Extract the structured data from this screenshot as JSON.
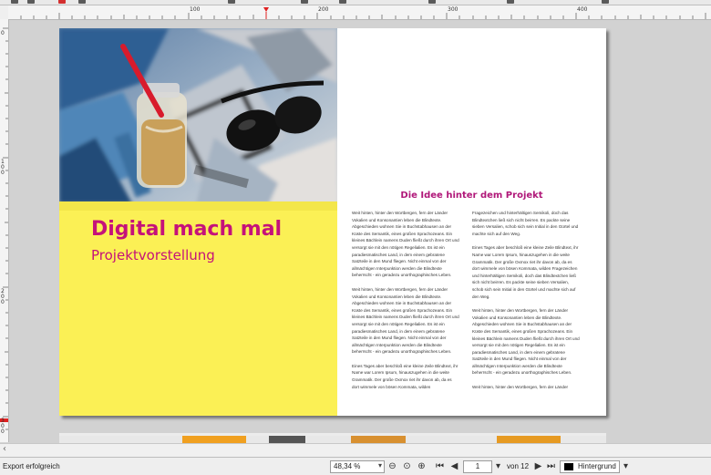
{
  "ruler": {
    "h_labels": [
      "100",
      "200",
      "300",
      "400"
    ],
    "v_labels": [
      "0",
      "100",
      "200",
      "300"
    ]
  },
  "document": {
    "title": "Digital mach mal",
    "subtitle": "Projektvorstellung",
    "heading": "Die Idee hinter dem Projekt",
    "col1": [
      "Weit hinten, hinter den Wortbergen, fern der Länder Vokalien und Konsonantien leben die Blindtexte. Abgeschieden wohnen Sie in Buchstabhausen an der Küste des Semantik, eines großen Sprachozeans. Ein kleines Bächlein namens Duden fließt durch ihren Ort und versorgt sie mit den nötigen Regelialien. Es ist ein paradiesmatisches Land, in dem einem gebratene Satzteile in den Mund fliegen. Nicht einmal von der allmächtigen Interpunktion werden die Blindtexte beherrscht - ein geradezu unorthographisches Leben.",
      "Weit hinten, hinter den Wortbergen, fern der Länder Vokalien und Konsonantien leben die Blindtexte. Abgeschieden wohnen Sie in Buchstabhausen an der Küste des Semantik, eines großen Sprachozeans. Ein kleines Bächlein namens Duden fließt durch ihren Ort und versorgt sie mit den nötigen Regelialien. Es ist ein paradiesmatisches Land, in dem einem gebratene Satzteile in den Mund fliegen. Nicht einmal von der allmächtigen Interpunktion werden die Blindtexte beherrscht - ein geradezu unorthographisches Leben.",
      "Eines Tages aber beschloß eine kleine Zeile Blindtext, ihr Name war Lorem Ipsum, hinauszugehen in die weite Grammatik. Der große Oxmox riet ihr davon ab, da es dort wimmele von bösen Kommata, wilden"
    ],
    "col2": [
      "Fragezeichen und hinterhältigen Semikoli, doch das Blindtextchen ließ sich nicht beirren. Es packte seine sieben Versalien, schob sich sein Initial in den Gürtel und machte sich auf den Weg.",
      "Eines Tages aber beschloß eine kleine Zeile Blindtext, ihr Name war Lorem Ipsum, hinauszugehen in die weite Grammatik. Der große Oxmox riet ihr davon ab, da es dort wimmele von bösen Kommata, wilden Fragezeichen und hinterhältigen Semikoli, doch das Blindtextchen ließ sich nicht beirren. Es packte seine sieben Versalien, schob sich sein Initial in den Gürtel und machte sich auf den Weg.",
      "Weit hinten, hinter den Wortbergen, fern der Länder Vokalien und Konsonantien leben die Blindtexte. Abgeschieden wohnen Sie in Buchstabhausen an der Küste des Semantik, eines großen Sprachozeans. Ein kleines Bächlein namens Duden fließt durch ihren Ort und versorgt sie mit den nötigen Regelialien. Es ist ein paradiesmatisches Land, in dem einem gebratene Satzteile in den Mund fliegen. Nicht einmal von der allmächtigen Interpunktion werden die Blindtexte beherrscht - ein geradezu unorthographisches Leben.",
      "Weit hinten, hinter den Wortbergen, fern der Länder"
    ]
  },
  "status": {
    "message": "Export erfolgreich",
    "zoom": "48,34 %",
    "page": "1",
    "of_pages": "von 12",
    "layer": "Hintergrund"
  },
  "colors": {
    "accent": "#c5127a",
    "page_yellow": "#fbf055"
  }
}
